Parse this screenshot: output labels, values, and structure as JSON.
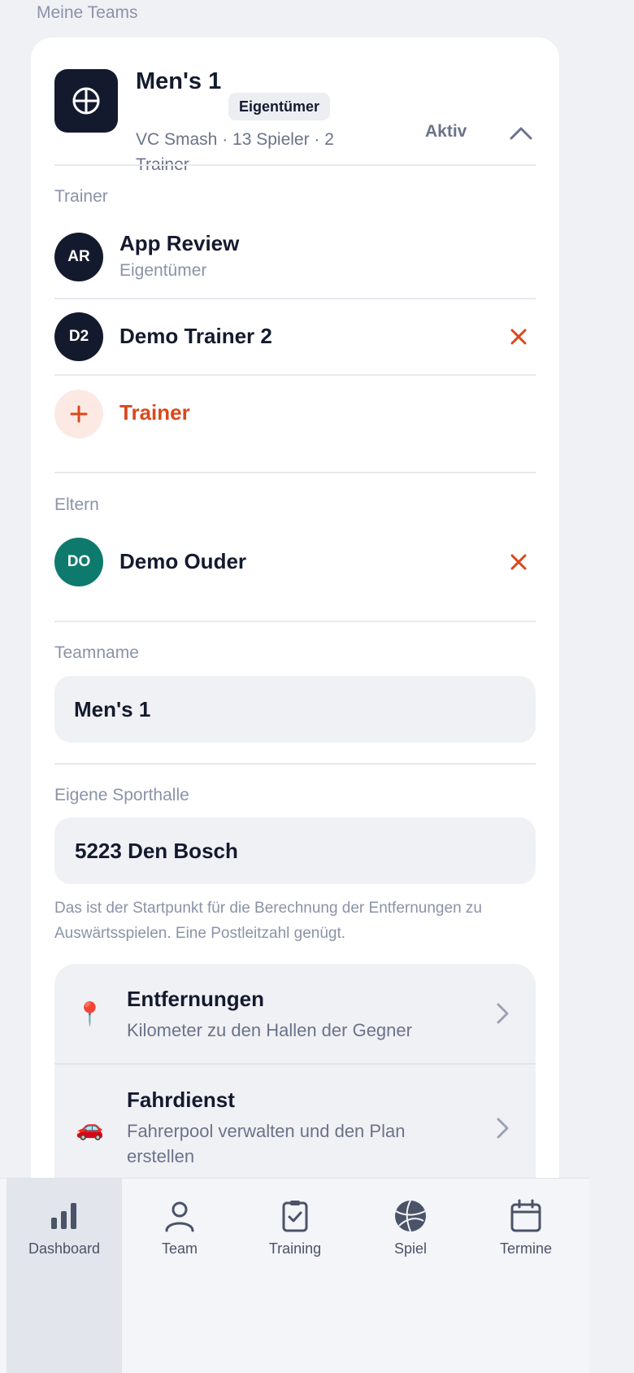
{
  "section_title": "Meine Teams",
  "team": {
    "name": "Men's 1",
    "badge": "Eigentümer",
    "meta": "VC Smash · 13 Spieler · 2 Trainer",
    "status": "Aktiv"
  },
  "trainers": {
    "label": "Trainer",
    "people": [
      {
        "initials": "AR",
        "name": "App Review",
        "role": "Eigentümer",
        "avatar_color": "#141a2e"
      },
      {
        "initials": "D2",
        "name": "Demo Trainer 2",
        "avatar_color": "#141a2e"
      }
    ],
    "add_label": "Trainer"
  },
  "parents": {
    "label": "Eltern",
    "people": [
      {
        "initials": "DO",
        "name": "Demo Ouder",
        "avatar_color": "#0e7a6d"
      }
    ]
  },
  "teamname_field": {
    "label": "Teamname",
    "value": "Men's 1"
  },
  "hall_field": {
    "label": "Eigene Sporthalle",
    "value": "5223 Den Bosch",
    "hint": "Das ist der Startpunkt für die Berechnung der Entfernungen zu Auswärtsspielen. Eine Postleitzahl genügt."
  },
  "links": [
    {
      "icon": "📍",
      "icon_name": "pin-icon",
      "title": "Entfernungen",
      "subtitle": "Kilometer zu den Hallen der Gegner"
    },
    {
      "icon": "🚗",
      "icon_name": "car-icon",
      "title": "Fahrdienst",
      "subtitle": "Fahrerpool verwalten und den Plan erstellen"
    }
  ],
  "tabs": [
    {
      "label": "Dashboard",
      "icon": "bar-chart-icon",
      "active": true
    },
    {
      "label": "Team",
      "icon": "person-icon",
      "active": false
    },
    {
      "label": "Training",
      "icon": "clipboard-check-icon",
      "active": false
    },
    {
      "label": "Spiel",
      "icon": "volleyball-icon",
      "active": false
    },
    {
      "label": "Termine",
      "icon": "calendar-icon",
      "active": false
    }
  ],
  "colors": {
    "accent": "#d8491c",
    "dark": "#141a2e",
    "teal": "#0e7a6d",
    "background": "#f0f1f5"
  }
}
